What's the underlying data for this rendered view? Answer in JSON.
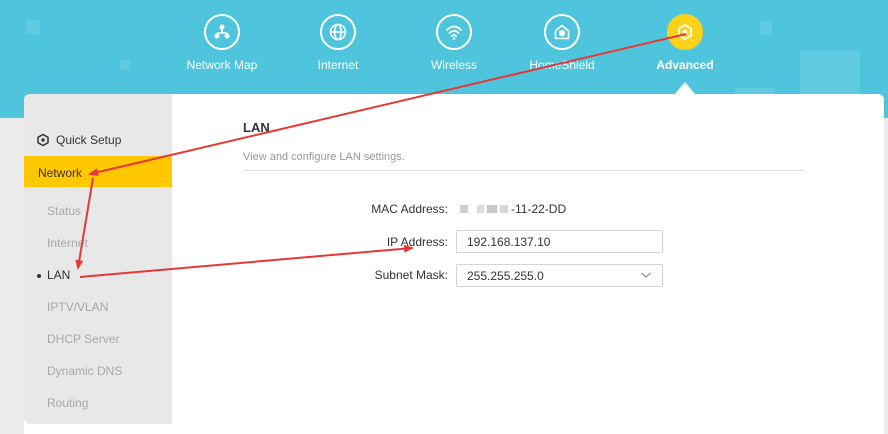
{
  "nav": {
    "items": [
      {
        "label": "Network Map",
        "icon": "network-map-icon"
      },
      {
        "label": "Internet",
        "icon": "globe-icon"
      },
      {
        "label": "Wireless",
        "icon": "wifi-icon"
      },
      {
        "label": "HomeShield",
        "icon": "home-shield-icon"
      },
      {
        "label": "Advanced",
        "icon": "gear-icon",
        "active": true
      }
    ]
  },
  "sidebar": {
    "quick_setup": "Quick Setup",
    "network": "Network",
    "items": [
      "Status",
      "Internet",
      "LAN",
      "IPTV/VLAN",
      "DHCP Server",
      "Dynamic DNS",
      "Routing"
    ],
    "active_item": "LAN"
  },
  "lan": {
    "title": "LAN",
    "description": "View and configure LAN settings.",
    "mac_label": "MAC Address:",
    "mac_value": "-11-22-DD",
    "ip_label": "IP Address:",
    "ip_value": "192.168.137.10",
    "mask_label": "Subnet Mask:",
    "mask_value": "255.255.255.0"
  },
  "colors": {
    "header": "#4ec5dc",
    "accent": "#ffc800",
    "annotation_arrow": "#e53935"
  }
}
